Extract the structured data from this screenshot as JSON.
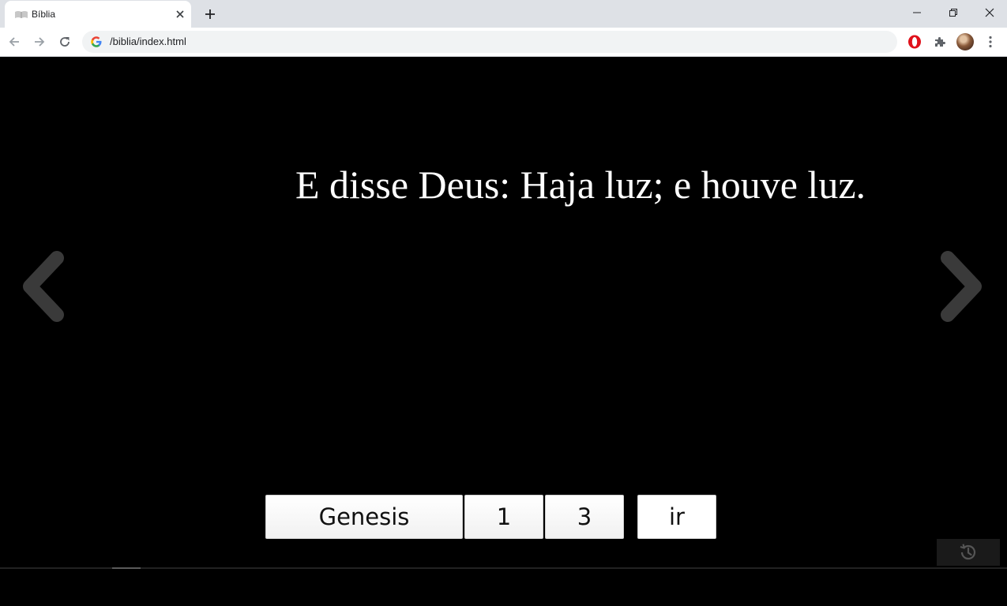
{
  "browser": {
    "tab_title": "Bíblia",
    "url": "/biblia/index.html"
  },
  "reader": {
    "verse_text": "E disse Deus: Haja luz; e houve luz.",
    "book": "Genesis",
    "chapter": "1",
    "verse": "3",
    "go_label": "ir",
    "progress_fraction": 0.028
  },
  "icons": {
    "prev": "chevron-left-icon",
    "next": "chevron-right-icon",
    "history": "history-icon"
  },
  "colors": {
    "background": "#000000",
    "text": "#ffffff",
    "arrow": "#3a3a3a"
  }
}
